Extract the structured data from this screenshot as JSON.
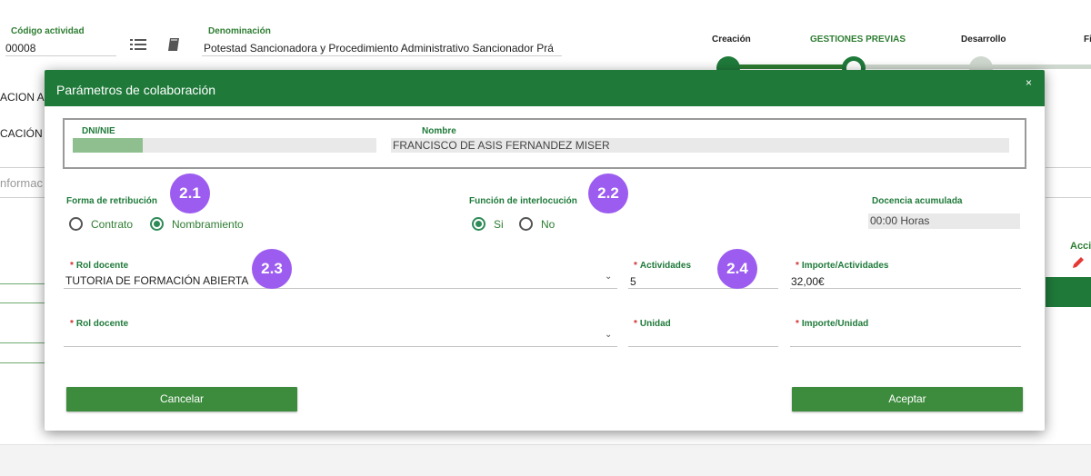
{
  "header": {
    "codigo_label": "Código actividad",
    "codigo_value": "00008",
    "denominacion_label": "Denominación",
    "denominacion_value": "Potestad Sancionadora y Procedimiento Administrativo Sancionador Prá",
    "steps": [
      {
        "label": "Creación",
        "state": "done"
      },
      {
        "label": "GESTIONES PREVIAS",
        "state": "active"
      },
      {
        "label": "Desarrollo",
        "state": "pending"
      },
      {
        "label": "Fi",
        "state": "pending"
      }
    ]
  },
  "background": {
    "side_texts": [
      "ACION A",
      "CACIÓN I",
      "nformac"
    ],
    "right_header": "Acci",
    "edit_icon": "pencil-icon"
  },
  "modal": {
    "title": "Parámetros de colaboración",
    "close_glyph": "×",
    "dni_label": "DNI/NIE",
    "dni_value": "",
    "nombre_label": "Nombre",
    "nombre_value": "FRANCISCO DE ASIS FERNANDEZ MISER",
    "forma_label": "Forma de retribución",
    "forma_options": [
      "Contrato",
      "Nombramiento"
    ],
    "forma_selected": "Nombramiento",
    "funcion_label": "Función de interlocución",
    "funcion_options": [
      "Si",
      "No"
    ],
    "funcion_selected": "Si",
    "docencia_label": "Docencia acumulada",
    "docencia_value": "00:00 Horas",
    "required_mark": "*",
    "rol1_label": "Rol docente",
    "rol1_value": "TUTORIA DE FORMACIÓN ABIERTA",
    "actividades_label": "Actividades",
    "actividades_value": "5",
    "importe_act_label": "Importe/Actividades",
    "importe_act_value": "32,00€",
    "rol2_label": "Rol docente",
    "rol2_value": "",
    "unidad_label": "Unidad",
    "unidad_value": "",
    "importe_unidad_label": "Importe/Unidad",
    "importe_unidad_value": "",
    "cancel_label": "Cancelar",
    "accept_label": "Aceptar",
    "chevron_glyph": "⌄"
  },
  "badges": [
    "2.1",
    "2.2",
    "2.3",
    "2.4"
  ],
  "colors": {
    "primary_green": "#1f7a3a",
    "button_green": "#3d8c3d",
    "badge_purple": "#9c5cf0",
    "required_red": "#d32f2f"
  }
}
